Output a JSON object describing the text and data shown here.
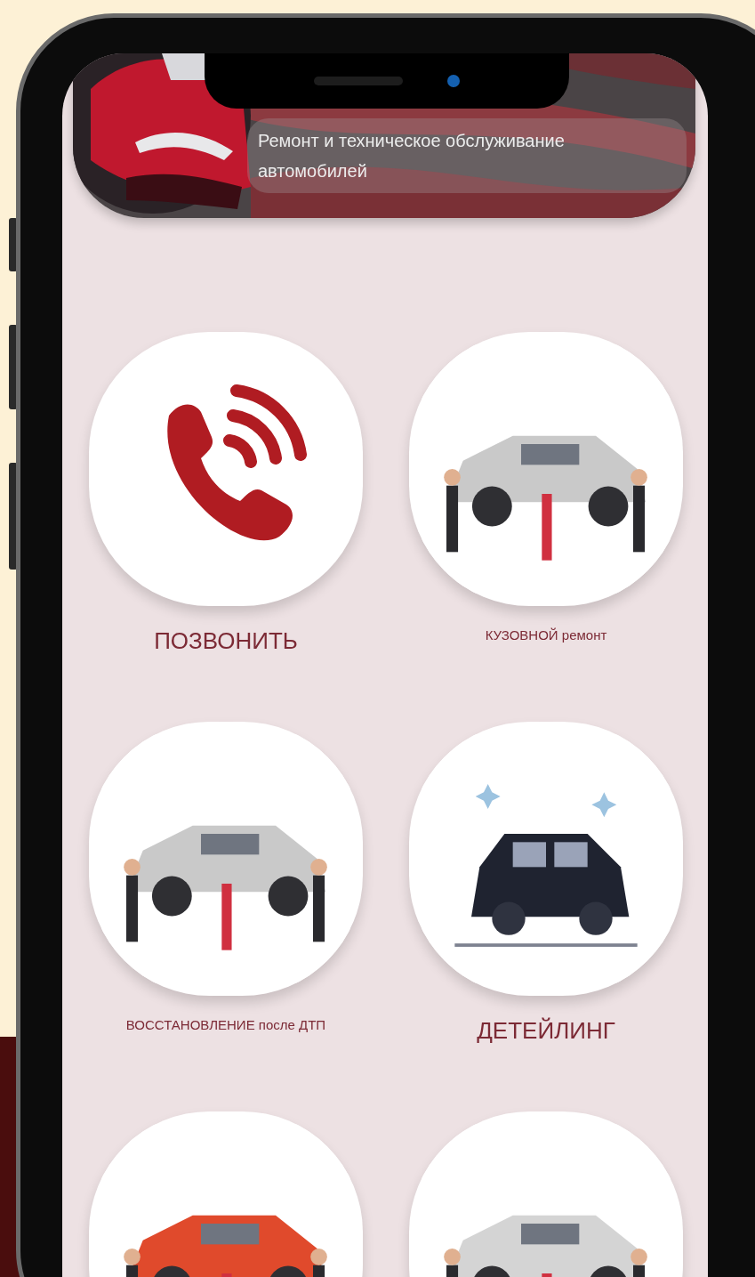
{
  "header": {
    "title": "Ремонт и техническое обслуживание автомобилей"
  },
  "tiles": [
    {
      "kind": "call",
      "label": "ПОЗВОНИТЬ",
      "emphasized": true
    },
    {
      "kind": "picture",
      "label": "КУЗОВНОЙ ремонт",
      "emphasized": false
    },
    {
      "kind": "picture",
      "label": "ВОССТАНОВЛЕНИЕ после ДТП",
      "emphasized": false
    },
    {
      "kind": "picture",
      "label": "ДЕТЕЙЛИНГ",
      "emphasized": true
    },
    {
      "kind": "picture"
    },
    {
      "kind": "picture"
    }
  ]
}
